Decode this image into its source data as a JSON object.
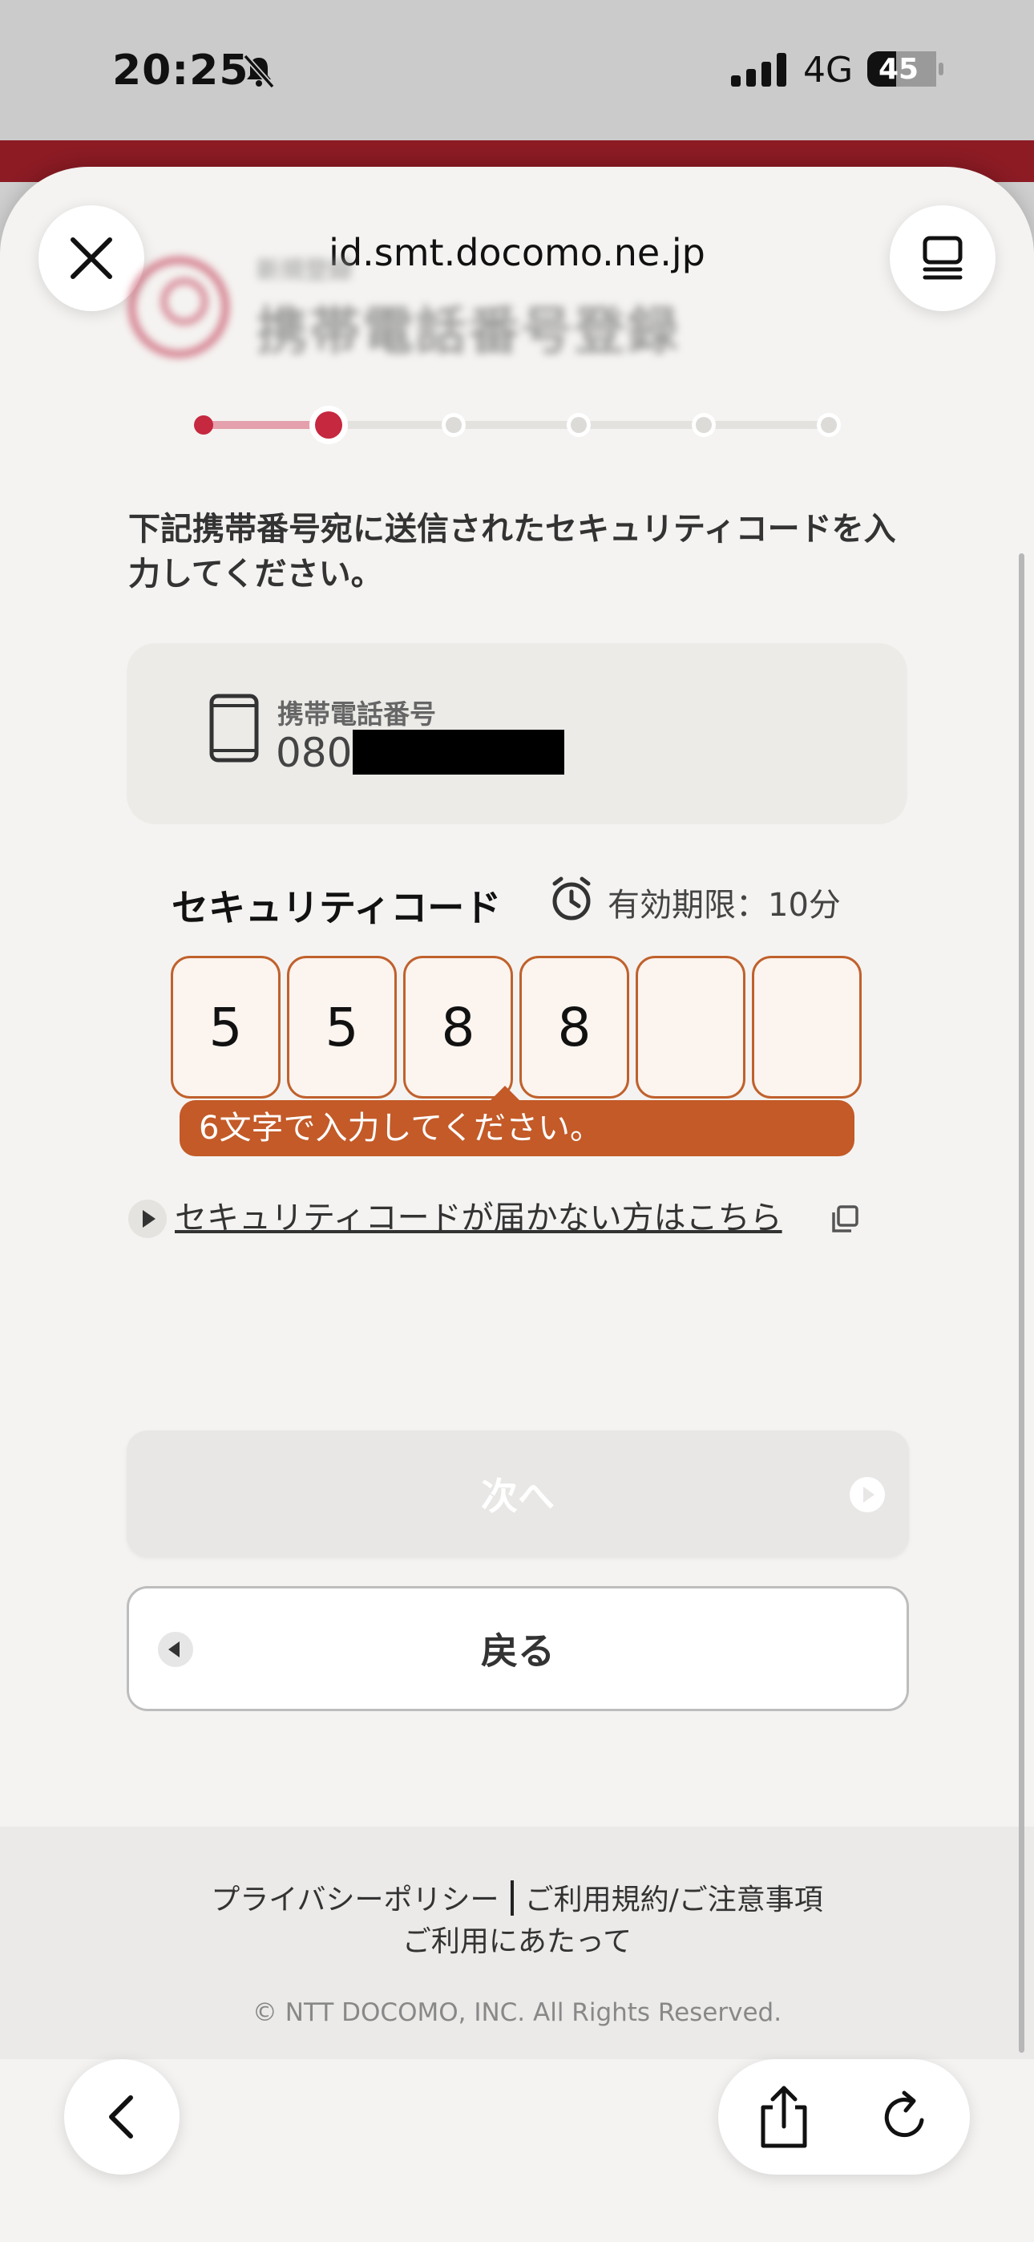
{
  "status_bar": {
    "time": "20:25",
    "network": "4G",
    "battery": "45"
  },
  "browser": {
    "url": "id.smt.docomo.ne.jp",
    "close_icon": "close-icon",
    "tabs_icon": "tabs-icon"
  },
  "page": {
    "small_header": "新規登録",
    "title": "携帯電話番号登録",
    "steps_total": 6,
    "current_step": 2,
    "lead_text": "下記携帯番号宛に送信されたセキュリティコードを入力してください。",
    "phone": {
      "label": "携帯電話番号",
      "number_prefix": "080"
    },
    "security_code": {
      "label": "セキュリティコード",
      "validity": "有効期限：10分",
      "digits": [
        "5",
        "5",
        "8",
        "8",
        "",
        ""
      ],
      "error": "6文字で入力してください。"
    },
    "help_link": "セキュリティコードが届かない方はこちら",
    "next_label": "次へ",
    "back_label": "戻る"
  },
  "footer": {
    "privacy": "プライバシーポリシー",
    "terms": "ご利用規約/ご注意事項",
    "usage": "ご利用にあたって",
    "copyright": "© NTT DOCOMO, INC. All Rights Reserved."
  },
  "colors": {
    "accent": "#c5283f",
    "error": "#c35a28",
    "code_border": "#c0612c"
  }
}
